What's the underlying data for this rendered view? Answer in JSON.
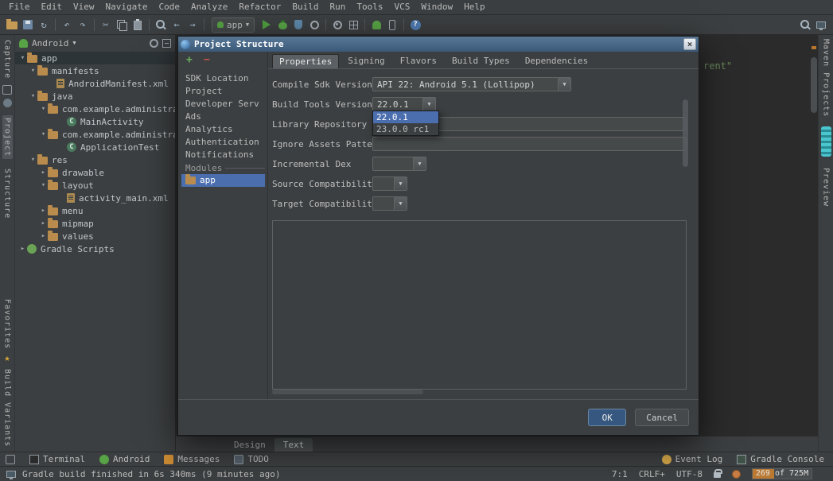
{
  "icons": {
    "dropdown": "▼",
    "tree_expanded": "▾",
    "tree_collapsed": "▸",
    "sync": "↻",
    "undo": "↶",
    "redo": "↷",
    "cut": "✂",
    "back": "←",
    "forward": "→",
    "help": "?",
    "plus": "+",
    "minus": "−",
    "close": "×",
    "star": "★",
    "class_letter": "C"
  },
  "colors": {
    "accent_blue": "#4b6eaf",
    "run_green": "#57a345",
    "memory_orange": "#bb7a33",
    "string_green": "#6a8759"
  },
  "menubar": {
    "items": [
      "File",
      "Edit",
      "View",
      "Navigate",
      "Code",
      "Analyze",
      "Refactor",
      "Build",
      "Run",
      "Tools",
      "VCS",
      "Window",
      "Help"
    ]
  },
  "toolbar": {
    "run_config_label": "app"
  },
  "left_stripe": {
    "capture": "Capture",
    "project": "Project",
    "structure": "Structure",
    "favorites": "Favorites",
    "build_variants": "Build Variants"
  },
  "right_stripe": {
    "maven": "Maven Projects",
    "preview": "Preview"
  },
  "project_panel": {
    "view_label": "Android",
    "tree": [
      {
        "label": "app"
      },
      {
        "label": "manifests"
      },
      {
        "label": "AndroidManifest.xml"
      },
      {
        "label": "java"
      },
      {
        "label": "com.example.administrator"
      },
      {
        "label": "MainActivity"
      },
      {
        "label": "com.example.administrator"
      },
      {
        "label": "ApplicationTest"
      },
      {
        "label": "res"
      },
      {
        "label": "drawable"
      },
      {
        "label": "layout"
      },
      {
        "label": "activity_main.xml"
      },
      {
        "label": "menu"
      },
      {
        "label": "mipmap"
      },
      {
        "label": "values"
      },
      {
        "label": "Gradle Scripts"
      }
    ]
  },
  "editor": {
    "visible_text": "rent\"",
    "design_tab": "Design",
    "text_tab": "Text"
  },
  "dialog": {
    "title": "Project Structure",
    "sidebar": {
      "items": [
        "SDK Location",
        "Project",
        "Developer Serv",
        "Ads",
        "Analytics",
        "Authentication",
        "Notifications"
      ],
      "modules_header": "Modules",
      "module_app": "app"
    },
    "tabs": [
      "Properties",
      "Signing",
      "Flavors",
      "Build Types",
      "Dependencies"
    ],
    "form": {
      "compile_sdk": {
        "label": "Compile Sdk Version",
        "value": "API 22: Android 5.1 (Lollipop)"
      },
      "build_tools": {
        "label": "Build Tools Version",
        "value": "22.0.1",
        "options": [
          "22.0.1",
          "23.0.0 rc1"
        ]
      },
      "library_repo": {
        "label": "Library Repository",
        "value": ""
      },
      "ignore_assets": {
        "label": "Ignore Assets Pattern",
        "value": ""
      },
      "incremental_dex": {
        "label": "Incremental Dex",
        "value": ""
      },
      "source_compat": {
        "label": "Source Compatibility",
        "value": ""
      },
      "target_compat": {
        "label": "Target Compatibility",
        "value": ""
      }
    },
    "buttons": {
      "ok": "OK",
      "cancel": "Cancel"
    }
  },
  "bottom_bar": {
    "left": [
      "Terminal",
      "Android",
      "Messages",
      "TODO"
    ],
    "right": [
      "Event Log",
      "Gradle Console"
    ]
  },
  "status_bar": {
    "message": "Gradle build finished in 6s 340ms (9 minutes ago)",
    "position": "7:1",
    "line_ending": "CRLF+",
    "encoding": "UTF-8",
    "memory": "269 of 725M"
  }
}
